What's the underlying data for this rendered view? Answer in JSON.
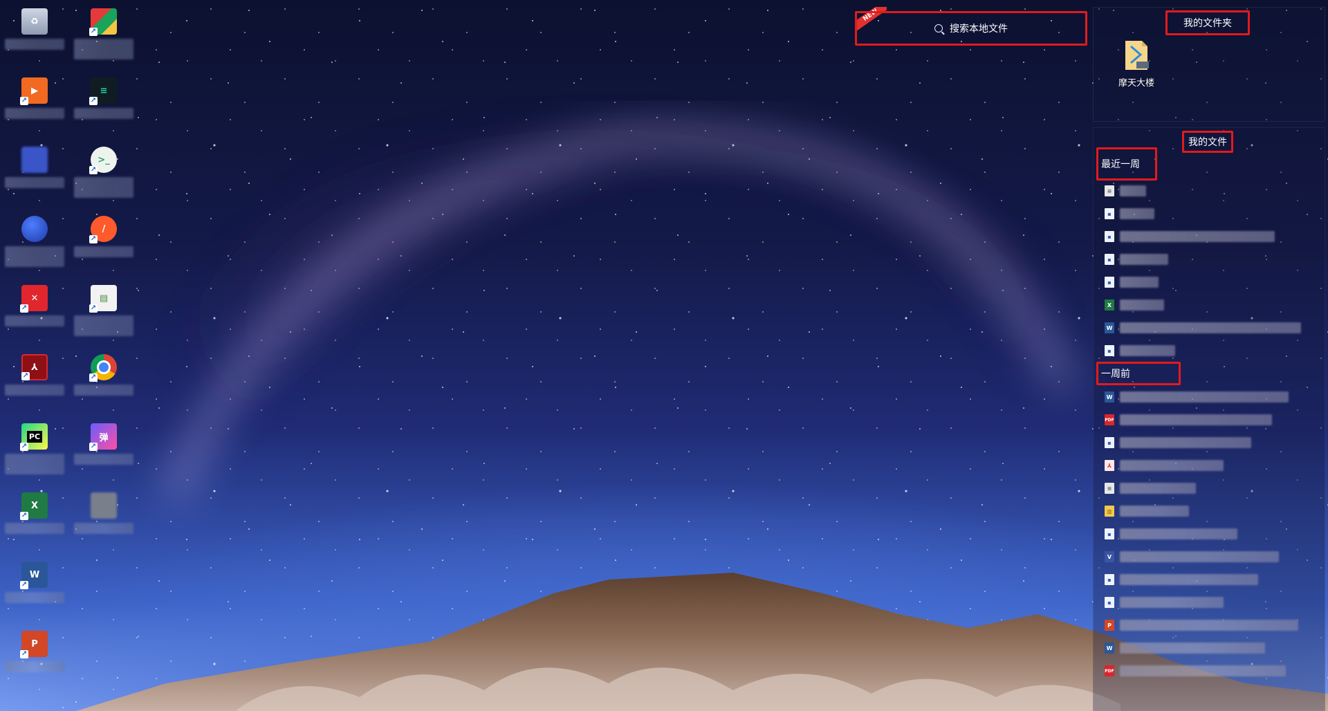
{
  "search": {
    "placeholder": "搜索本地文件",
    "badge": "NEW"
  },
  "folder_panel": {
    "title": "我的文件夹",
    "items": [
      {
        "label": "摩天大楼",
        "icon": "mkv-file-icon",
        "badge": "MKV"
      }
    ]
  },
  "files_panel": {
    "title": "我的文件",
    "sections": [
      {
        "label": "最近一周",
        "files": [
          {
            "icon": "text-file-icon"
          },
          {
            "icon": "generic-file-icon"
          },
          {
            "icon": "generic-file-icon"
          },
          {
            "icon": "generic-file-icon"
          },
          {
            "icon": "generic-file-icon"
          },
          {
            "icon": "excel-file-icon"
          },
          {
            "icon": "word-file-icon"
          },
          {
            "icon": "generic-file-icon"
          }
        ]
      },
      {
        "label": "一周前",
        "files": [
          {
            "icon": "word-file-icon"
          },
          {
            "icon": "pdf-file-icon"
          },
          {
            "icon": "generic-file-icon"
          },
          {
            "icon": "acrobat-file-icon"
          },
          {
            "icon": "text-file-icon"
          },
          {
            "icon": "zip-file-icon"
          },
          {
            "icon": "generic-file-icon"
          },
          {
            "icon": "visio-file-icon"
          },
          {
            "icon": "generic-file-icon"
          },
          {
            "icon": "generic-file-icon"
          },
          {
            "icon": "powerpoint-file-icon"
          },
          {
            "icon": "word-file-icon"
          },
          {
            "icon": "pdf-file-icon"
          }
        ]
      }
    ]
  },
  "desktop_icons": [
    {
      "name": "recycle-bin-icon"
    },
    {
      "name": "sheets-shortcut-icon"
    },
    {
      "name": "slides-app-shortcut-icon"
    },
    {
      "name": "terminal-app-shortcut-icon"
    },
    {
      "name": "blurred-app-icon"
    },
    {
      "name": "chat-bubble-shortcut-icon"
    },
    {
      "name": "blue-orb-app-icon"
    },
    {
      "name": "orange-app-shortcut-icon"
    },
    {
      "name": "red-x-app-shortcut-icon"
    },
    {
      "name": "document-stack-shortcut-icon"
    },
    {
      "name": "pdf-reader-shortcut-icon"
    },
    {
      "name": "chrome-shortcut-icon"
    },
    {
      "name": "pycharm-shortcut-icon"
    },
    {
      "name": "bullet-chat-shortcut-icon"
    },
    {
      "name": "excel-shortcut-icon"
    },
    {
      "name": "blurred-file-icon"
    },
    {
      "name": "word-shortcut-icon"
    },
    {
      "name": "powerpoint-shortcut-icon"
    }
  ],
  "colors": {
    "highlight_border": "#e21b1b",
    "sky_top": "#0c1130",
    "sky_horizon": "#7ea1f3",
    "panel_bg": "rgba(18,22,56,0.35)"
  }
}
